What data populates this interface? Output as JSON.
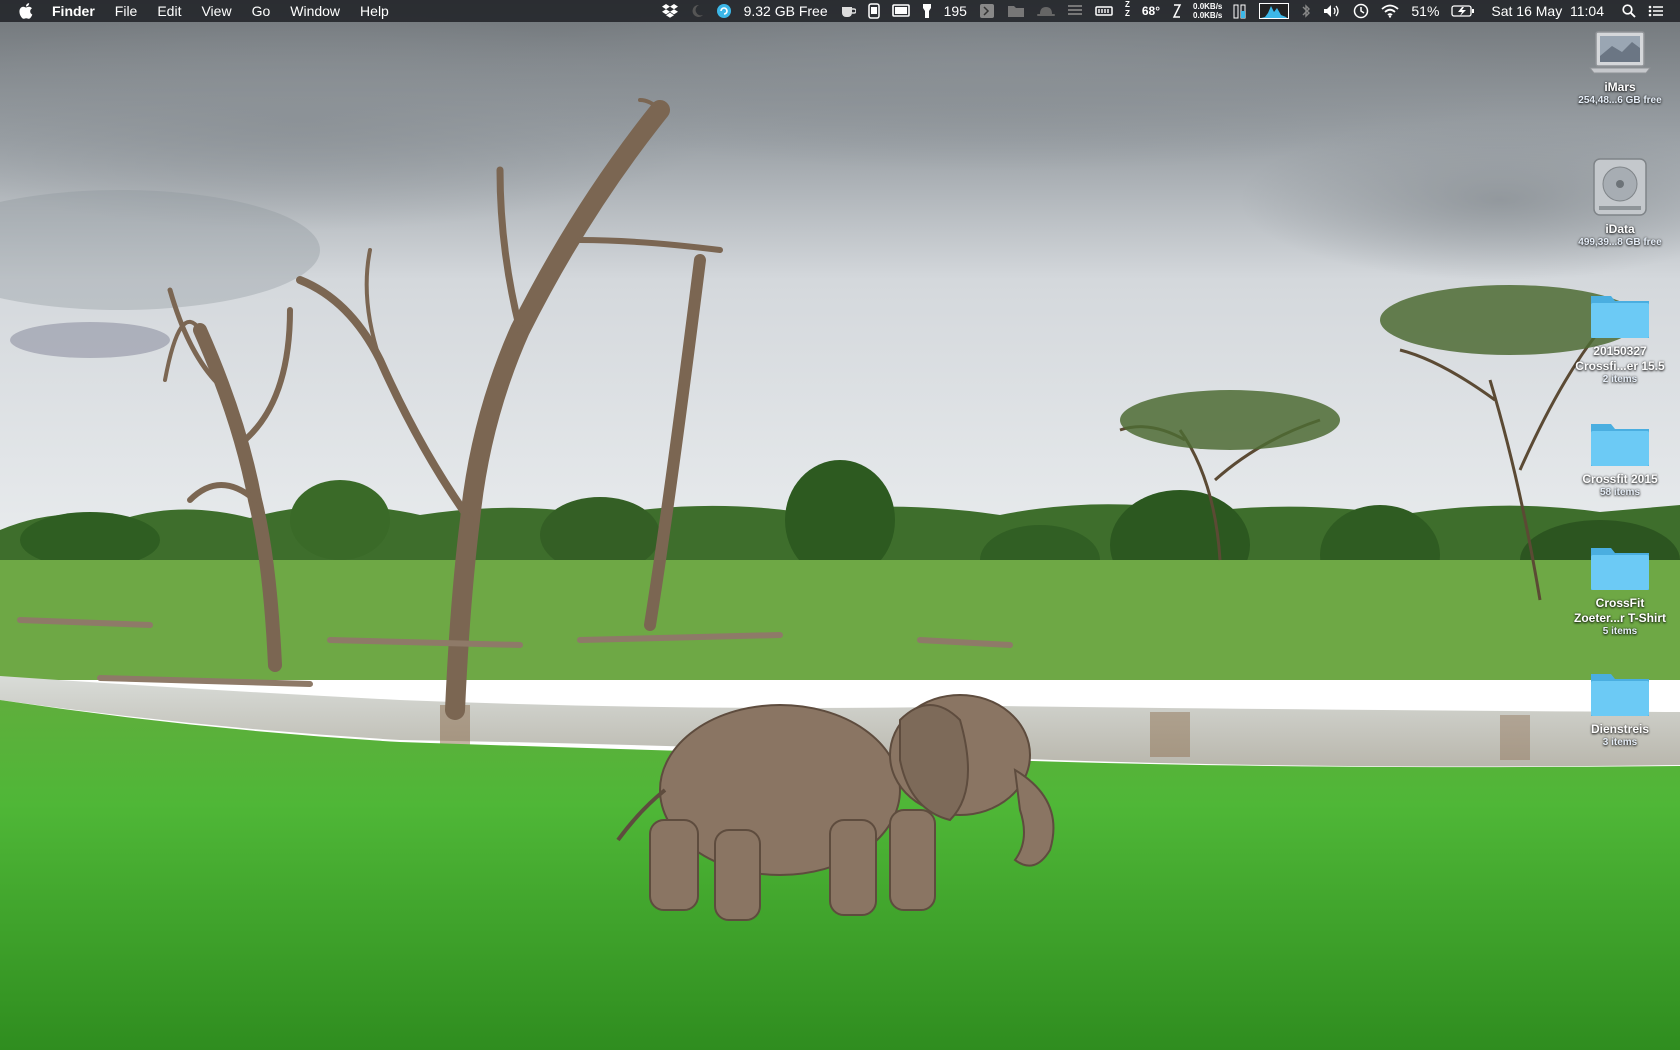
{
  "menubar": {
    "app_name": "Finder",
    "menus": [
      "File",
      "Edit",
      "View",
      "Go",
      "Window",
      "Help"
    ],
    "status": {
      "disk_free": "9.32 GB Free",
      "count": "195",
      "temperature": "68°",
      "net_up": "0.0KB/s",
      "net_down": "0.0KB/s",
      "battery_percent": "51%",
      "datetime": "Sat 16 May  11:04",
      "zz_top": "Z",
      "zz_bottom": "Z"
    }
  },
  "desktop_icons": [
    {
      "name": "iMars",
      "sub": "254,48...6 GB free",
      "icon": "laptop-icon"
    },
    {
      "name": "iData",
      "sub": "499,39...8 GB free",
      "icon": "hard-drive-icon"
    },
    {
      "name": "20150327\nCrossfi...er 15.5",
      "line1": "20150327",
      "line2": "Crossfi...er 15.5",
      "sub": "2 items",
      "icon": "folder-icon"
    },
    {
      "name": "Crossfit 2015",
      "line1": "Crossfit 2015",
      "sub": "58 items",
      "icon": "folder-icon"
    },
    {
      "name": "CrossFit Zoeter...r T-Shirt",
      "line1": "CrossFit",
      "line2": "Zoeter...r T-Shirt",
      "sub": "5 items",
      "icon": "folder-icon"
    },
    {
      "name": "Dienstreis",
      "line1": "Dienstreis",
      "sub": "3 items",
      "icon": "folder-icon"
    }
  ],
  "colors": {
    "menubar_bg": "#202226",
    "folder_blue": "#5ec3f2",
    "grass": "#4db33a",
    "sky": "#c9ced4"
  }
}
